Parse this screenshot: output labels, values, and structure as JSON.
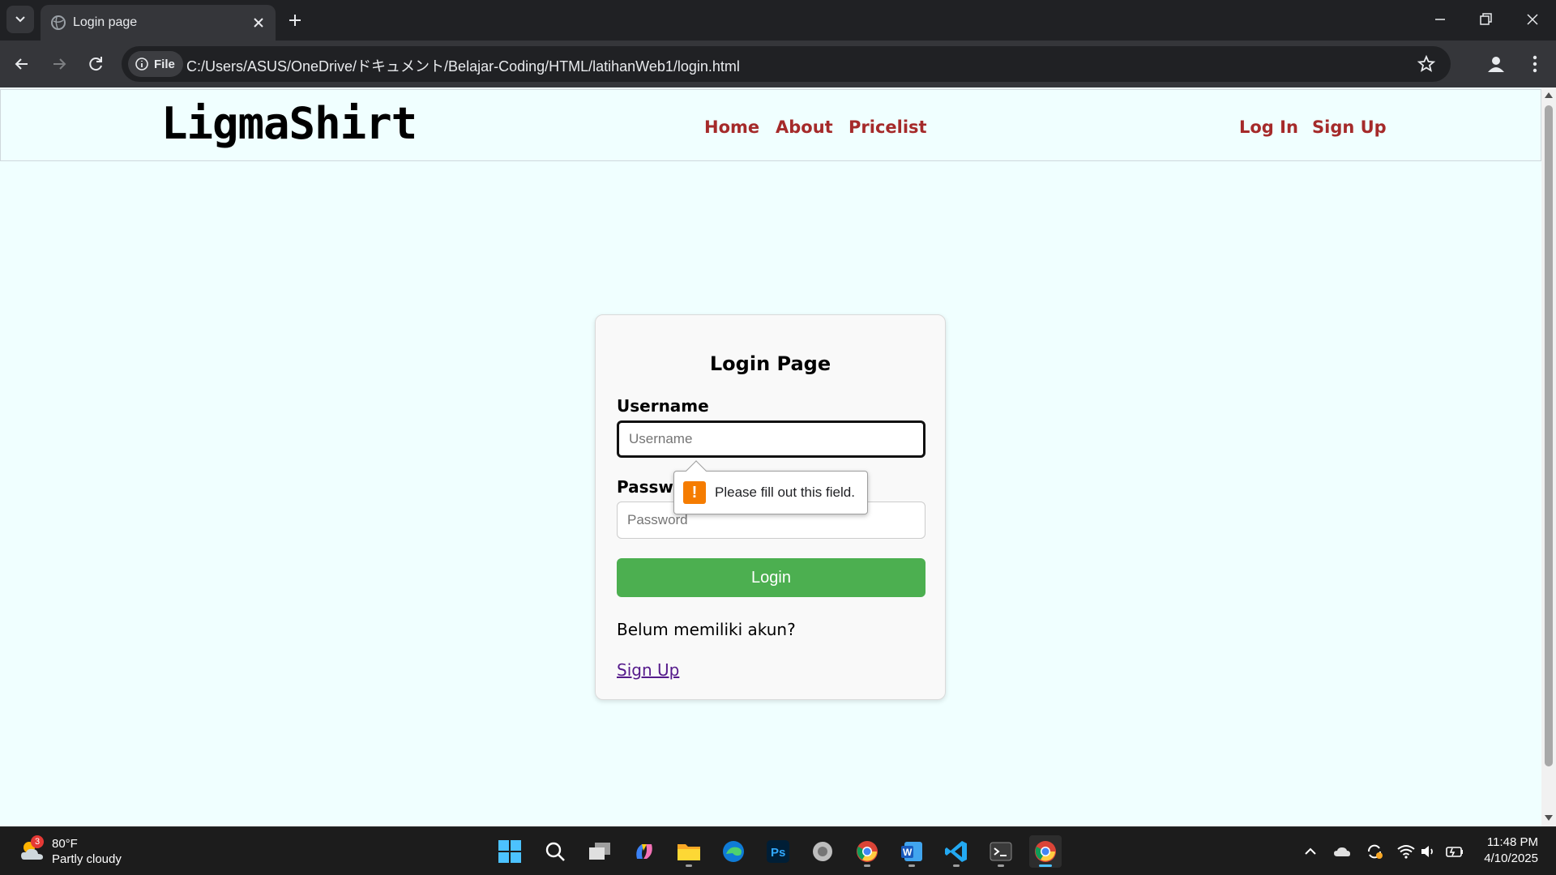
{
  "browser": {
    "tab_title": "Login page",
    "file_chip": "File",
    "url": "C:/Users/ASUS/OneDrive/ドキュメント/Belajar-Coding/HTML/latihanWeb1/login.html"
  },
  "site": {
    "brand": "LigmaShirt",
    "nav": {
      "home": "Home",
      "about": "About",
      "pricelist": "Pricelist"
    },
    "auth": {
      "login": "Log In",
      "signup": "Sign Up"
    },
    "link_color": "#a52a2a"
  },
  "login_card": {
    "title": "Login Page",
    "username_label": "Username",
    "username_placeholder": "Username",
    "password_label": "Password",
    "password_placeholder": "Password",
    "submit_label": "Login",
    "no_account_text": "Belum memiliki akun?",
    "signup_link": "Sign Up",
    "button_color": "#4caf50"
  },
  "validation_tooltip": {
    "icon": "warning-icon",
    "text": "Please fill out this field."
  },
  "taskbar": {
    "weather_temp": "80°F",
    "weather_desc": "Partly cloudy",
    "weather_badge": "3",
    "time": "11:48 PM",
    "date": "4/10/2025"
  }
}
